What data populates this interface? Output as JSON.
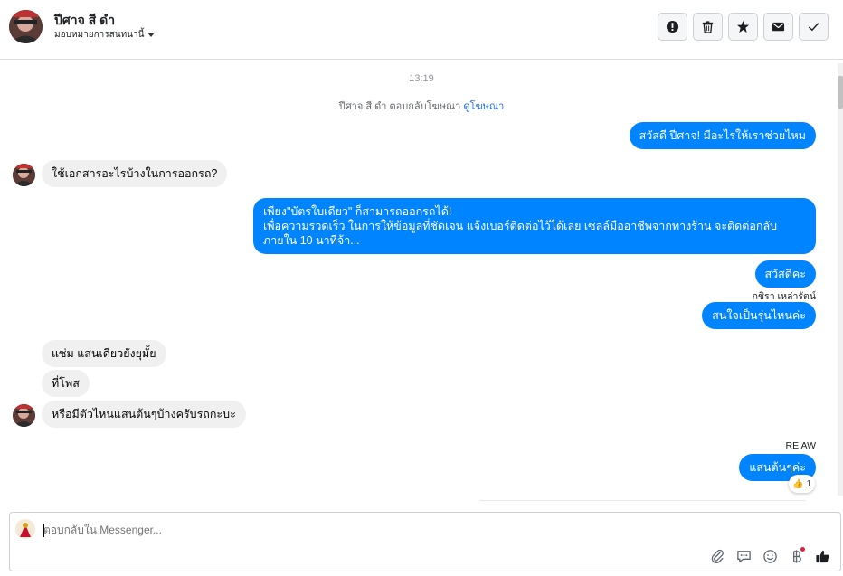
{
  "header": {
    "name": "ปีศาจ สี ดำ",
    "assign_label": "มอบหมายการสนทนานี้",
    "actions": [
      {
        "icon": "alert-icon",
        "label": "mark-spam"
      },
      {
        "icon": "trash-icon",
        "label": "delete"
      },
      {
        "icon": "star-icon",
        "label": "star"
      },
      {
        "icon": "envelope-icon",
        "label": "unread"
      },
      {
        "icon": "check-icon",
        "label": "done"
      }
    ]
  },
  "thread": {
    "timestamp": "13:19",
    "ad_reply_text": "ปีศาจ สี ดำ ตอบกลับโฆษณา",
    "ad_reply_link": "ดูโฆษณา",
    "messages": {
      "m1": "สวัสดี ปีศาจ! มีอะไรให้เราช่วยไหม",
      "m2": "ใช้เอกสารอะไรบ้างในการออกรถ?",
      "m3_line1": "เพียง\"บัตรใบเดียว\" ก็สามารถออกรถได้!",
      "m3_line2": "เพื่อความรวดเร็ว ในการให้ข้อมูลที่ชัดเจน แจ้งเบอร์ติดต่อไว้ได้เลย เซลล์มืออาชีพจากทางร้าน จะติดต่อกลับภายใน 10 นาทีจ้า...",
      "m4": "สวัสดีคะ",
      "m4_sender": "กชิรา เหล่ารัตน์",
      "m5": "สนใจเป็นรุ่นไหนค่ะ",
      "m6": "แซ่ม แสนเดียวยังยุมั้ย",
      "m7": "ที่โพส",
      "m8": "หรือมีตัวไหนแสนต้นๆบ้างครับรถกะบะ",
      "m9_sender": "RE AW",
      "m9": "แสนต้นๆค่ะ",
      "m9_reaction_count": "1"
    }
  },
  "composer": {
    "placeholder": "ตอบกลับใน Messenger...",
    "tools": [
      "paperclip-icon",
      "quick-reply-icon",
      "emoji-icon",
      "payment-icon",
      "thumbs-up-icon"
    ]
  },
  "colors": {
    "outgoing_bubble": "#0084ff",
    "incoming_bubble": "#f0f0f0",
    "link": "#216fdb"
  }
}
